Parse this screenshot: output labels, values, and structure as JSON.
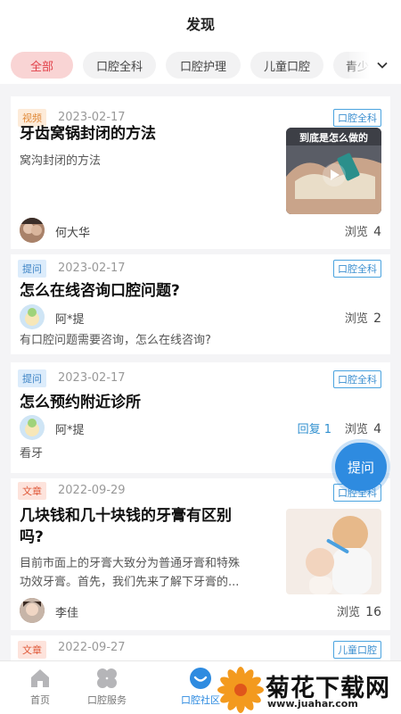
{
  "header": {
    "title": "发现"
  },
  "tabs": [
    {
      "label": "全部",
      "active": true
    },
    {
      "label": "口腔全科",
      "active": false
    },
    {
      "label": "口腔护理",
      "active": false
    },
    {
      "label": "儿童口腔",
      "active": false
    },
    {
      "label": "青少",
      "active": false
    }
  ],
  "posts": [
    {
      "tag": "视频",
      "date": "2023-02-17",
      "category": "口腔全科",
      "title": "牙齿窝锅封闭的方法",
      "desc": "窝沟封闭的方法",
      "author": "何大华",
      "views_label": "浏览",
      "views": "4",
      "thumb_caption": "到底是怎么做的"
    },
    {
      "tag": "提问",
      "date": "2023-02-17",
      "category": "口腔全科",
      "title": "怎么在线咨询口腔问题?",
      "author": "阿*提",
      "desc": "有口腔问题需要咨询，怎么在线咨询?",
      "views_label": "浏览",
      "views": "2"
    },
    {
      "tag": "提问",
      "date": "2023-02-17",
      "category": "口腔全科",
      "title": "怎么预约附近诊所",
      "author": "阿*提",
      "desc": "看牙",
      "reply_label": "回复",
      "replies": "1",
      "views_label": "浏览",
      "views": "4"
    },
    {
      "tag": "文章",
      "date": "2022-09-29",
      "category": "口腔全科",
      "title_line1": "几块钱和几十块钱的牙膏有区别",
      "title_line2": "吗?",
      "desc_line1": "目前市面上的牙膏大致分为普通牙膏和特殊",
      "desc_line2": "功效牙膏。首先，我们先来了解下牙膏的...",
      "author": "李佳",
      "views_label": "浏览",
      "views": "16"
    },
    {
      "tag": "文章",
      "date": "2022-09-27",
      "category": "儿童口腔"
    }
  ],
  "fab": {
    "label": "提问"
  },
  "nav": [
    {
      "label": "首页",
      "icon": "home-icon"
    },
    {
      "label": "口腔服务",
      "icon": "grid-icon"
    },
    {
      "label": "口腔社区",
      "icon": "community-icon",
      "active": true
    }
  ],
  "watermark": {
    "text": "菊花下载网",
    "url": "www.juahar.com"
  },
  "colors": {
    "accent": "#2e8be0",
    "active_tab": "#e2414a",
    "active_tab_bg": "#f9d4d4"
  }
}
